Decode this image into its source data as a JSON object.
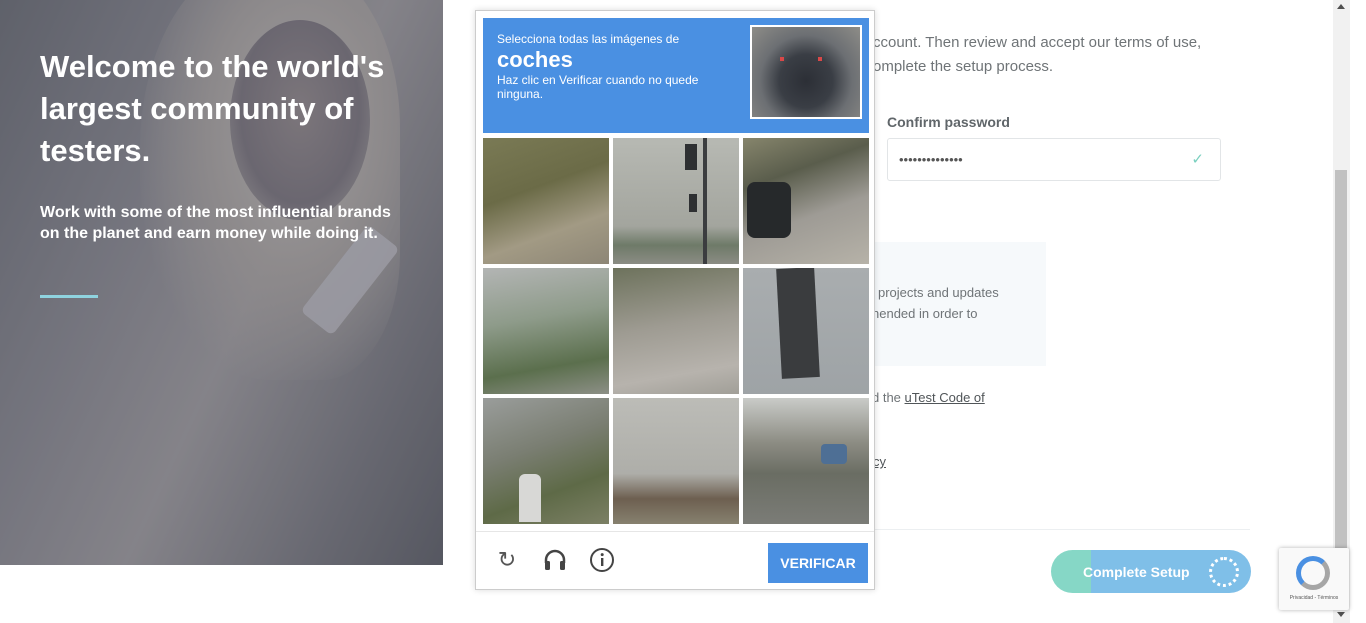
{
  "hero": {
    "title": "Welcome to the world's largest community of testers.",
    "subtitle": "Work with some of the most influential brands on the planet and earn money while doing it."
  },
  "form": {
    "intro_line1": "ccount. Then review and accept our terms of use,",
    "intro_line2": "omplete the setup process.",
    "confirm_password_label": "Confirm password",
    "confirm_password_value": "••••••••••••••",
    "notice_line1": "projects and updates",
    "notice_line2": "nended in order to",
    "code_of_conduct_prefix": "d the ",
    "code_of_conduct_link": "uTest Code of",
    "privacy_fragment": "cy",
    "complete_button": "Complete Setup"
  },
  "captcha": {
    "instruction_line1": "Selecciona todas las imágenes de",
    "target": "coches",
    "instruction_line2": "Haz clic en Verificar cuando no quede ninguna.",
    "verify_button": "VERIFICAR",
    "icons": [
      "reload-icon",
      "audio-icon",
      "info-icon"
    ]
  },
  "badge": {
    "terms": "Privacidad - Términos"
  },
  "colors": {
    "captcha_blue": "#4a90e2",
    "accent_teal": "#8fd3df",
    "button_green": "#86d7c6",
    "button_blue": "#7fbfe8"
  }
}
